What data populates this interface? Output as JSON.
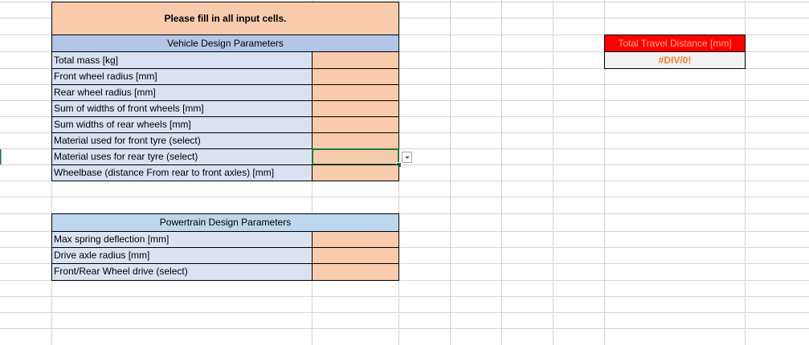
{
  "note": {
    "text": "Please fill in all input cells."
  },
  "vehicle": {
    "header": "Vehicle Design Parameters",
    "rows": [
      "Total mass [kg]",
      "Front wheel radius [mm]",
      "Rear wheel radius [mm]",
      "Sum of widths of front wheels [mm]",
      "Sum widths of rear wheels [mm]",
      "Material used for front tyre (select)",
      "Material uses for rear tyre (select)",
      "Wheelbase (distance From rear to front axles) [mm]"
    ]
  },
  "powertrain": {
    "header": "Powertrain Design Parameters",
    "rows": [
      "Max spring deflection [mm]",
      "Drive axle radius [mm]",
      "Front/Rear Wheel drive (select)"
    ]
  },
  "result": {
    "label": "Total Travel Distance [mm]",
    "value": "#DIV/0!"
  },
  "colors": {
    "input_fill": "#f8cbad",
    "label_fill": "#d9e1f2",
    "header_fill": "#b4c6e7",
    "result_header": "#ff0000",
    "error_text": "#ed7d31",
    "selection": "#217346"
  }
}
